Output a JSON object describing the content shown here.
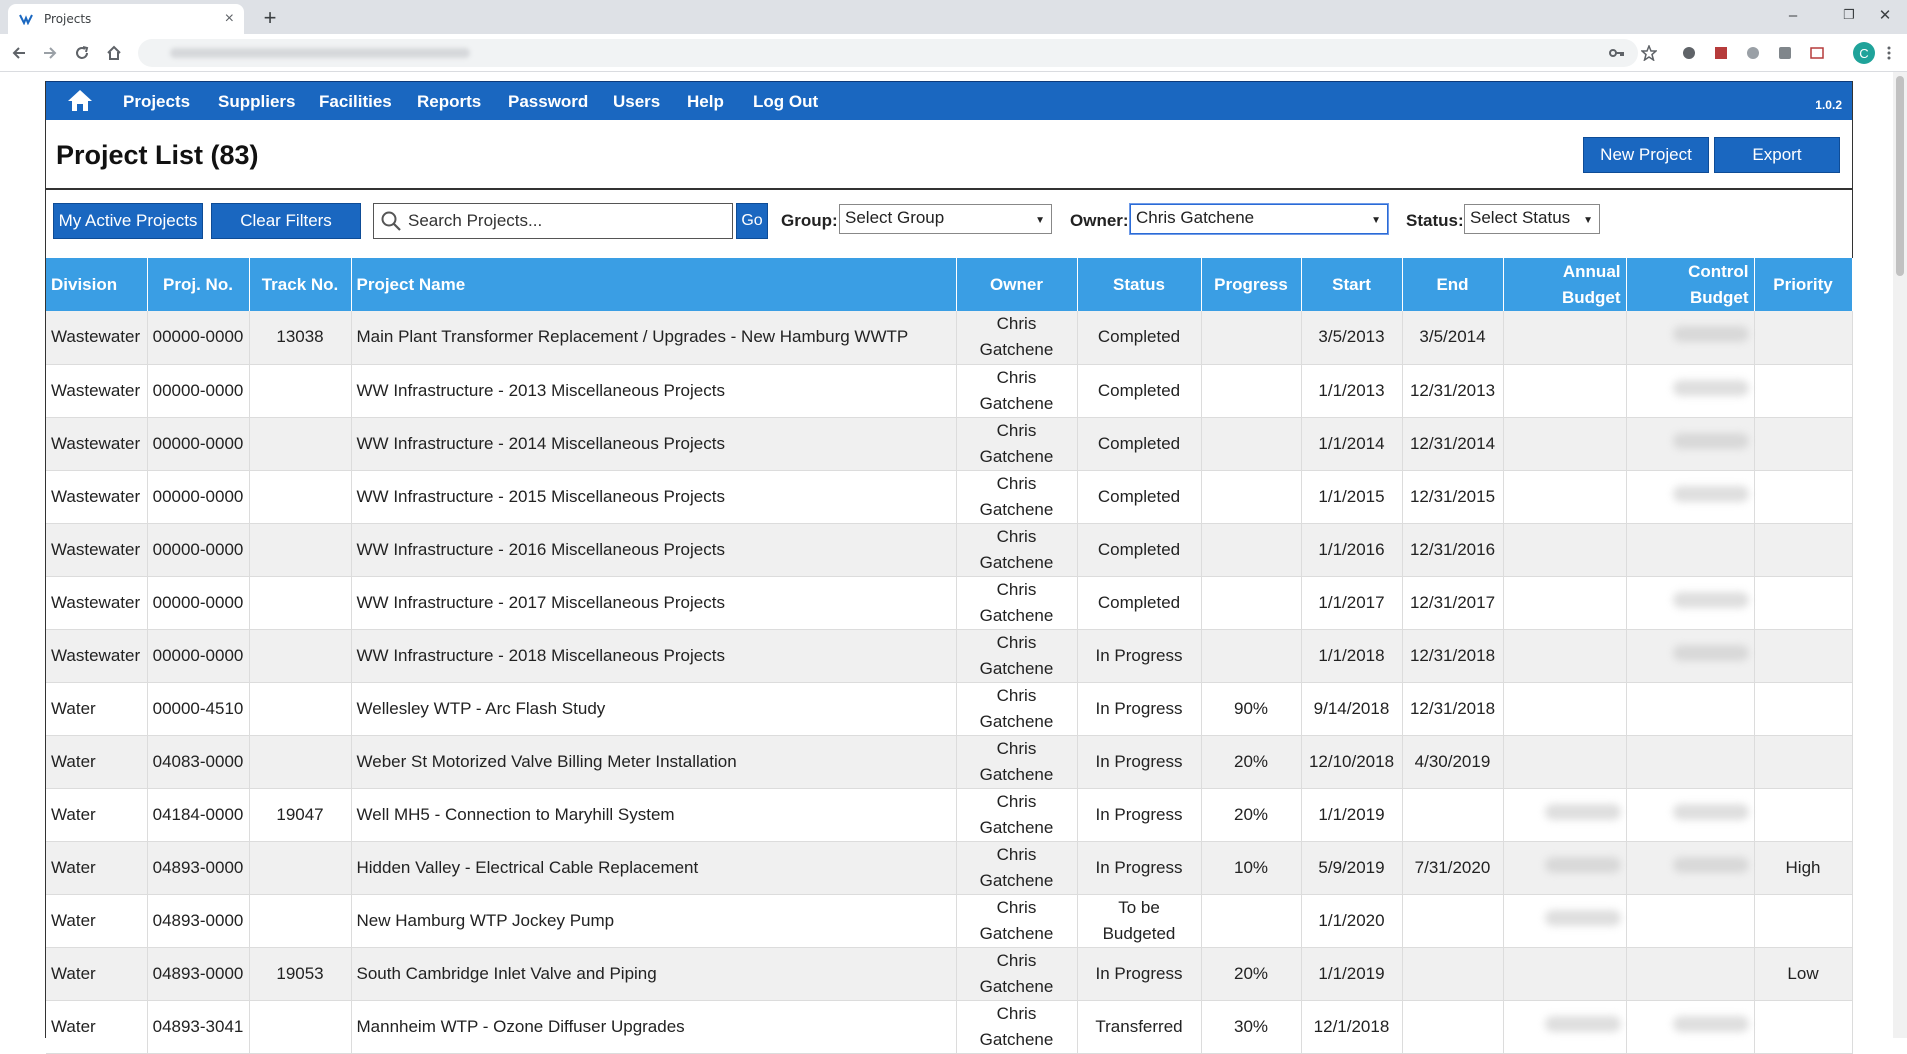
{
  "browser": {
    "tab_title": "Projects",
    "tab_close": "×",
    "new_tab": "+",
    "win_min": "–",
    "win_restore": "❐",
    "win_close": "✕",
    "avatar_letter": "C"
  },
  "nav": {
    "items": [
      "Projects",
      "Suppliers",
      "Facilities",
      "Reports",
      "Password",
      "Users",
      "Help",
      "Log Out"
    ],
    "version": "1.0.2"
  },
  "page": {
    "title": "Project List (83)",
    "new_project": "New Project",
    "export": "Export"
  },
  "filters": {
    "my_active": "My Active Projects",
    "clear": "Clear Filters",
    "search_placeholder": "Search Projects...",
    "go": "Go",
    "group_label": "Group:",
    "group_value": "Select Group",
    "owner_label": "Owner:",
    "owner_value": "Chris Gatchene",
    "status_label": "Status:",
    "status_value": "Select Status"
  },
  "table": {
    "headers": {
      "division": "Division",
      "proj_no": "Proj. No.",
      "track_no": "Track No.",
      "name": "Project Name",
      "owner": "Owner",
      "status": "Status",
      "progress": "Progress",
      "start": "Start",
      "end": "End",
      "annual_1": "Annual",
      "annual_2": "Budget",
      "control_1": "Control",
      "control_2": "Budget",
      "priority": "Priority"
    },
    "rows": [
      {
        "division": "Wastewater",
        "proj_no": "00000-0000",
        "track_no": "13038",
        "name": "Main Plant Transformer Replacement / Upgrades - New Hamburg WWTP",
        "owner_1": "Chris",
        "owner_2": "Gatchene",
        "status_1": "Completed",
        "status_2": "",
        "progress": "",
        "start": "3/5/2013",
        "end": "3/5/2014",
        "priority": ""
      },
      {
        "division": "Wastewater",
        "proj_no": "00000-0000",
        "track_no": "",
        "name": "WW Infrastructure - 2013 Miscellaneous Projects",
        "owner_1": "Chris",
        "owner_2": "Gatchene",
        "status_1": "Completed",
        "status_2": "",
        "progress": "",
        "start": "1/1/2013",
        "end": "12/31/2013",
        "priority": ""
      },
      {
        "division": "Wastewater",
        "proj_no": "00000-0000",
        "track_no": "",
        "name": "WW Infrastructure - 2014 Miscellaneous Projects",
        "owner_1": "Chris",
        "owner_2": "Gatchene",
        "status_1": "Completed",
        "status_2": "",
        "progress": "",
        "start": "1/1/2014",
        "end": "12/31/2014",
        "priority": ""
      },
      {
        "division": "Wastewater",
        "proj_no": "00000-0000",
        "track_no": "",
        "name": "WW Infrastructure - 2015 Miscellaneous Projects",
        "owner_1": "Chris",
        "owner_2": "Gatchene",
        "status_1": "Completed",
        "status_2": "",
        "progress": "",
        "start": "1/1/2015",
        "end": "12/31/2015",
        "priority": ""
      },
      {
        "division": "Wastewater",
        "proj_no": "00000-0000",
        "track_no": "",
        "name": "WW Infrastructure - 2016 Miscellaneous Projects",
        "owner_1": "Chris",
        "owner_2": "Gatchene",
        "status_1": "Completed",
        "status_2": "",
        "progress": "",
        "start": "1/1/2016",
        "end": "12/31/2016",
        "priority": ""
      },
      {
        "division": "Wastewater",
        "proj_no": "00000-0000",
        "track_no": "",
        "name": "WW Infrastructure - 2017 Miscellaneous Projects",
        "owner_1": "Chris",
        "owner_2": "Gatchene",
        "status_1": "Completed",
        "status_2": "",
        "progress": "",
        "start": "1/1/2017",
        "end": "12/31/2017",
        "priority": ""
      },
      {
        "division": "Wastewater",
        "proj_no": "00000-0000",
        "track_no": "",
        "name": "WW Infrastructure - 2018 Miscellaneous Projects",
        "owner_1": "Chris",
        "owner_2": "Gatchene",
        "status_1": "In Progress",
        "status_2": "",
        "progress": "",
        "start": "1/1/2018",
        "end": "12/31/2018",
        "priority": ""
      },
      {
        "division": "Water",
        "proj_no": "00000-4510",
        "track_no": "",
        "name": "Wellesley WTP - Arc Flash Study",
        "owner_1": "Chris",
        "owner_2": "Gatchene",
        "status_1": "In Progress",
        "status_2": "",
        "progress": "90%",
        "start": "9/14/2018",
        "end": "12/31/2018",
        "priority": ""
      },
      {
        "division": "Water",
        "proj_no": "04083-0000",
        "track_no": "",
        "name": "Weber St Motorized Valve Billing Meter Installation",
        "owner_1": "Chris",
        "owner_2": "Gatchene",
        "status_1": "In Progress",
        "status_2": "",
        "progress": "20%",
        "start": "12/10/2018",
        "end": "4/30/2019",
        "priority": ""
      },
      {
        "division": "Water",
        "proj_no": "04184-0000",
        "track_no": "19047",
        "name": "Well MH5 - Connection to Maryhill System",
        "owner_1": "Chris",
        "owner_2": "Gatchene",
        "status_1": "In Progress",
        "status_2": "",
        "progress": "20%",
        "start": "1/1/2019",
        "end": "",
        "priority": ""
      },
      {
        "division": "Water",
        "proj_no": "04893-0000",
        "track_no": "",
        "name": "Hidden Valley - Electrical Cable Replacement",
        "owner_1": "Chris",
        "owner_2": "Gatchene",
        "status_1": "In Progress",
        "status_2": "",
        "progress": "10%",
        "start": "5/9/2019",
        "end": "7/31/2020",
        "priority": "High"
      },
      {
        "division": "Water",
        "proj_no": "04893-0000",
        "track_no": "",
        "name": "New Hamburg WTP Jockey Pump",
        "owner_1": "Chris",
        "owner_2": "Gatchene",
        "status_1": "To be",
        "status_2": "Budgeted",
        "progress": "",
        "start": "1/1/2020",
        "end": "",
        "priority": ""
      },
      {
        "division": "Water",
        "proj_no": "04893-0000",
        "track_no": "19053",
        "name": "South Cambridge Inlet Valve and Piping",
        "owner_1": "Chris",
        "owner_2": "Gatchene",
        "status_1": "In Progress",
        "status_2": "",
        "progress": "20%",
        "start": "1/1/2019",
        "end": "",
        "priority": "Low"
      },
      {
        "division": "Water",
        "proj_no": "04893-3041",
        "track_no": "",
        "name": "Mannheim WTP - Ozone Diffuser Upgrades",
        "owner_1": "Chris",
        "owner_2": "Gatchene",
        "status_1": "Transferred",
        "status_2": "",
        "progress": "30%",
        "start": "12/1/2018",
        "end": "",
        "priority": ""
      }
    ]
  }
}
